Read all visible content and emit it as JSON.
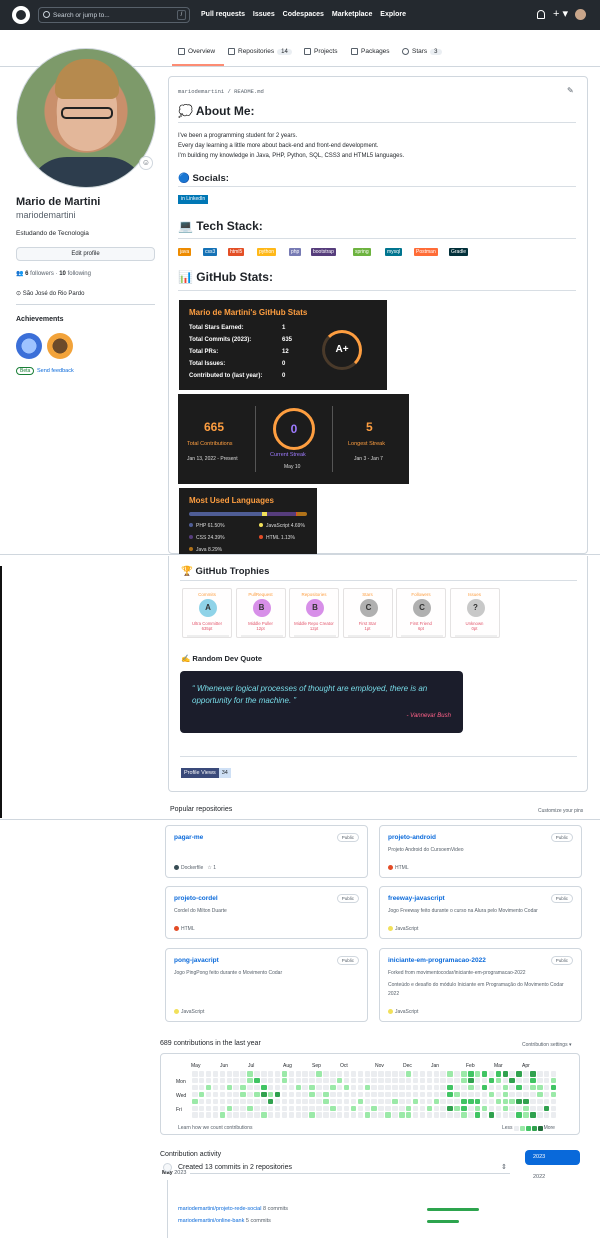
{
  "nav": {
    "search_placeholder": "Search or jump to...",
    "search_shortcut": "/",
    "links": [
      "Pull requests",
      "Issues",
      "Codespaces",
      "Marketplace",
      "Explore"
    ],
    "plus": "+ ▾"
  },
  "tabs": [
    {
      "label": "Overview"
    },
    {
      "label": "Repositories",
      "count": "14"
    },
    {
      "label": "Projects"
    },
    {
      "label": "Packages"
    },
    {
      "label": "Stars",
      "count": "3"
    }
  ],
  "profile": {
    "fullname": "Mario de Martini",
    "username": "mariodemartini",
    "bio": "Estudando de Tecnologia",
    "edit_button": "Edit profile",
    "followers_count": "6",
    "followers_label": "followers",
    "following_count": "10",
    "following_label": "following",
    "location": "São José do Rio Pardo",
    "achievements_title": "Achievements",
    "beta_tag": "Beta",
    "feedback": "Send feedback"
  },
  "readme": {
    "path_user": "mariodemartini",
    "path_sep": " / ",
    "path_file": "README.md",
    "about_title": "💭 About Me:",
    "about_lines": [
      "I've been a programming student for 2 years.",
      "Every day learning a little more about back-end and front-end development.",
      "I'm building my knowledge in Java, PHP, Python, SQL, CSS3 and HTML5 languages."
    ],
    "socials_title": "🔵 Socials:",
    "linkedin": "LinkedIn",
    "techstack_title": "💻 Tech Stack:",
    "tech": [
      {
        "name": "java",
        "color": "#ED8B00"
      },
      {
        "name": "css3",
        "color": "#1572B6"
      },
      {
        "name": "html5",
        "color": "#E34F26"
      },
      {
        "name": "python",
        "color": "#ffb818"
      },
      {
        "name": "php",
        "color": "#777BB4"
      },
      {
        "name": "bootstrap",
        "color": "#563D7C"
      },
      {
        "name": "spring",
        "color": "#6DB33F"
      },
      {
        "name": "mysql",
        "color": "#00758f"
      },
      {
        "name": "Postman",
        "color": "#FF6C37"
      },
      {
        "name": "Gradle",
        "color": "#02303A"
      }
    ],
    "ghstats_title": "📊 GitHub Stats:",
    "trophies_title": "🏆 GitHub Trophies",
    "quote_title": "✍️ Random Dev Quote"
  },
  "stats_card": {
    "title": "Mario de Martini's GitHub Stats",
    "rows": [
      {
        "label": "Total Stars Earned:",
        "value": "1"
      },
      {
        "label": "Total Commits (2023):",
        "value": "635"
      },
      {
        "label": "Total PRs:",
        "value": "12"
      },
      {
        "label": "Total Issues:",
        "value": "0"
      },
      {
        "label": "Contributed to (last year):",
        "value": "0"
      }
    ],
    "grade": "A+"
  },
  "streak_card": {
    "total": "665",
    "total_label": "Total Contributions",
    "total_range": "Jan 13, 2022 - Present",
    "current": "0",
    "current_label": "Current Streak",
    "current_range": "May 10",
    "longest": "5",
    "longest_label": "Longest Streak",
    "longest_range": "Jan 3 - Jan 7"
  },
  "lang_card": {
    "title": "Most Used Languages",
    "langs": [
      {
        "name": "PHP 61.50%",
        "color": "#4F5D95",
        "pct": 61.5
      },
      {
        "name": "JavaScript 4.69%",
        "color": "#f1e05a",
        "pct": 4.69
      },
      {
        "name": "CSS 24.39%",
        "color": "#563d7c",
        "pct": 24.39
      },
      {
        "name": "HTML 1.13%",
        "color": "#e34c26",
        "pct": 1.13
      },
      {
        "name": "Java 8.29%",
        "color": "#b07219",
        "pct": 8.29
      }
    ]
  },
  "trophies": [
    {
      "title": "Commits",
      "rank": "A",
      "name": "Ultra Committer",
      "pts": "635pt",
      "color": "#8fd3e8"
    },
    {
      "title": "PullRequest",
      "rank": "B",
      "name": "Middle Puller",
      "pts": "12pt",
      "color": "#d78fe8"
    },
    {
      "title": "Repositories",
      "rank": "B",
      "name": "Middle Repo Creator",
      "pts": "12pt",
      "color": "#d78fe8"
    },
    {
      "title": "Stars",
      "rank": "C",
      "name": "First Star",
      "pts": "1pt",
      "color": "#b0b0b0"
    },
    {
      "title": "Followers",
      "rank": "C",
      "name": "First Friend",
      "pts": "6pt",
      "color": "#b0b0b0"
    },
    {
      "title": "Issues",
      "rank": "?",
      "name": "Unknown",
      "pts": "0pt",
      "color": "#c8c8c8"
    }
  ],
  "quote": {
    "text": "Whenever logical processes of thought are employed, there is an opportunity for the machine.",
    "author": "- Vannevar Bush"
  },
  "profile_views": {
    "label": "Profile Views",
    "value": "34"
  },
  "popular": {
    "title": "Popular repositories",
    "customize": "Customize your pins",
    "repos": [
      {
        "name": "pagar-me",
        "visibility": "Public",
        "desc": "",
        "lang": "Dockerfile",
        "lang_color": "#384d54",
        "stars": "1"
      },
      {
        "name": "projeto-android",
        "visibility": "Public",
        "desc": "Projeto Android do CursoemVideo",
        "lang": "HTML",
        "lang_color": "#e34c26"
      },
      {
        "name": "projeto-cordel",
        "visibility": "Public",
        "desc": "Cordel do Milton Duarte",
        "lang": "HTML",
        "lang_color": "#e34c26"
      },
      {
        "name": "freeway-javascript",
        "visibility": "Public",
        "desc": "Jogo Freeway feito durante o curso na Alura pelo Movimento Codar",
        "lang": "JavaScript",
        "lang_color": "#f1e05a"
      },
      {
        "name": "pong-javacript",
        "visibility": "Public",
        "desc": "Jogo PingPong feito durante o Movimento Codar",
        "lang": "JavaScript",
        "lang_color": "#f1e05a"
      },
      {
        "name": "iniciante-em-programacao-2022",
        "visibility": "Public",
        "forked": "Forked from movimentocodar/iniciante-em-programacao-2022",
        "desc": "Conteúdo e desafio do módulo Iniciante em Programação do Movimento Codar 2022",
        "lang": "JavaScript",
        "lang_color": "#f1e05a"
      }
    ]
  },
  "contributions": {
    "title": "689 contributions in the last year",
    "settings": "Contribution settings ▾",
    "months": [
      "May",
      "Jun",
      "Jul",
      "Aug",
      "Sep",
      "Oct",
      "Nov",
      "Dec",
      "Jan",
      "Feb",
      "Mar",
      "Apr"
    ],
    "days": [
      "Mon",
      "Wed",
      "Fri"
    ],
    "learn": "Learn how we count contributions",
    "less": "Less",
    "more": "More"
  },
  "activity": {
    "title": "Contribution activity",
    "years": [
      "2023",
      "2022"
    ],
    "month": "May",
    "month_year": "2023",
    "summary": "Created 13 commits in 2 repositories",
    "repos": [
      {
        "name": "mariodemartini/projeto-rede-social",
        "commits": "8 commits",
        "ratio": 1.0
      },
      {
        "name": "mariodemartini/online-bank",
        "commits": "5 commits",
        "ratio": 0.62
      }
    ]
  }
}
